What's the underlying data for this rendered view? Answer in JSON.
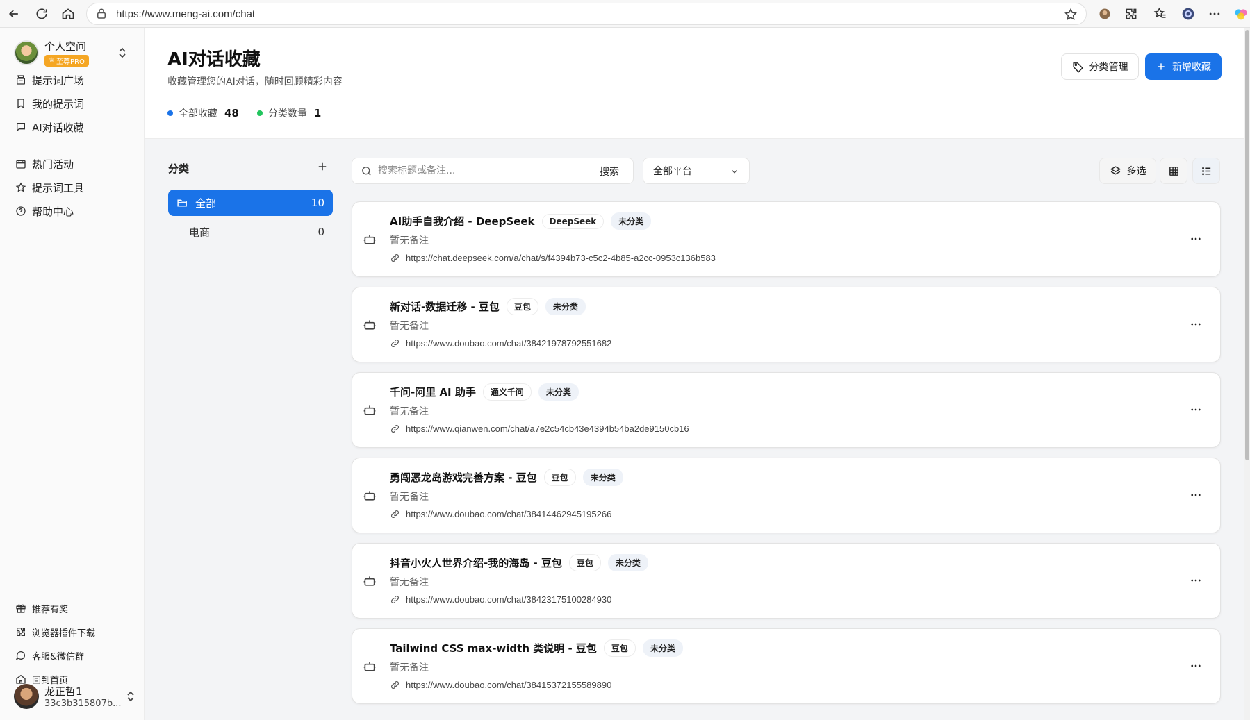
{
  "browser": {
    "url": "https://www.meng-ai.com/chat"
  },
  "sidebar": {
    "space_name": "个人空间",
    "pro_badge": "至尊PRO",
    "items": [
      {
        "label": "提示词广场",
        "icon": "store-icon"
      },
      {
        "label": "我的提示词",
        "icon": "bookmark-icon"
      },
      {
        "label": "AI对话收藏",
        "icon": "chat-icon"
      },
      {
        "label": "热门活动",
        "icon": "calendar-icon"
      },
      {
        "label": "提示词工具",
        "icon": "star-icon"
      },
      {
        "label": "帮助中心",
        "icon": "help-icon"
      }
    ],
    "bottom_items": [
      {
        "label": "推荐有奖",
        "icon": "gift-icon"
      },
      {
        "label": "浏览器插件下载",
        "icon": "puzzle-icon"
      },
      {
        "label": "客服&微信群",
        "icon": "message-icon"
      },
      {
        "label": "回到首页",
        "icon": "home-icon"
      }
    ],
    "user": {
      "name": "龙正哲1",
      "id": "33c3b315807b..."
    }
  },
  "header": {
    "title": "AI对话收藏",
    "subtitle": "收藏管理您的AI对话，随时回顾精彩内容",
    "stats": [
      {
        "label": "全部收藏",
        "value": "48",
        "color": "#1a73e8"
      },
      {
        "label": "分类数量",
        "value": "1",
        "color": "#22c55e"
      }
    ],
    "tag_manage_label": "分类管理",
    "new_label": "新增收藏"
  },
  "categories": {
    "title": "分类",
    "items": [
      {
        "name": "全部",
        "count": "10",
        "active": true
      },
      {
        "name": "电商",
        "count": "0",
        "active": false
      }
    ]
  },
  "toolbar": {
    "search_placeholder": "搜索标题或备注...",
    "search_button": "搜索",
    "platform_selected": "全部平台",
    "multi_select": "多选"
  },
  "cards": [
    {
      "title": "AI助手自我介绍 - DeepSeek",
      "platform": "DeepSeek",
      "category": "未分类",
      "note": "暂无备注",
      "url": "https://chat.deepseek.com/a/chat/s/f4394b73-c5c2-4b85-a2cc-0953c136b583"
    },
    {
      "title": "新对话-数据迁移 - 豆包",
      "platform": "豆包",
      "category": "未分类",
      "note": "暂无备注",
      "url": "https://www.doubao.com/chat/38421978792551682"
    },
    {
      "title": "千问-阿里 AI 助手",
      "platform": "通义千问",
      "category": "未分类",
      "note": "暂无备注",
      "url": "https://www.qianwen.com/chat/a7e2c54cb43e4394b54ba2de9150cb16"
    },
    {
      "title": "勇闯恶龙岛游戏完善方案 - 豆包",
      "platform": "豆包",
      "category": "未分类",
      "note": "暂无备注",
      "url": "https://www.doubao.com/chat/38414462945195266"
    },
    {
      "title": "抖音小火人世界介绍-我的海岛 - 豆包",
      "platform": "豆包",
      "category": "未分类",
      "note": "暂无备注",
      "url": "https://www.doubao.com/chat/38423175100284930"
    },
    {
      "title": "Tailwind CSS max-width 类说明 - 豆包",
      "platform": "豆包",
      "category": "未分类",
      "note": "暂无备注",
      "url": "https://www.doubao.com/chat/38415372155589890"
    }
  ]
}
